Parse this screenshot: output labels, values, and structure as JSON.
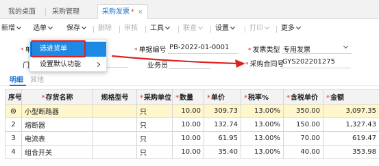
{
  "tabs": [
    {
      "label": "我的桌面"
    },
    {
      "label": "采购管理"
    },
    {
      "label": "采购发票",
      "modified_mark": "*",
      "close": "×"
    }
  ],
  "toolbar": {
    "add": "新增",
    "select_order": "选单",
    "save": "保存",
    "delete": "删除",
    "audit": "审核",
    "tools": "工具",
    "linked_query": "联查",
    "settings": "设置",
    "print": "打印",
    "more": "更多"
  },
  "menu": {
    "items": [
      {
        "label": "选进货单"
      },
      {
        "label": "设置默认功能"
      }
    ]
  },
  "form": {
    "doc_no_label": "单据编号",
    "doc_no_value": "PB-2022-01-0001",
    "invoice_type_label": "发票类型",
    "invoice_type_value": "专用发票",
    "salesman_label": "业务员",
    "purchase_contract_label": "采购合同号",
    "purchase_contract_value": "GYS202201275",
    "partial_label_1": "单",
    "partial_label_2": "门"
  },
  "subtabs": {
    "detail": "明细",
    "other": "其他"
  },
  "table": {
    "headers": [
      "序号",
      "存货名称",
      "规格型号",
      "采购单位",
      "数量",
      "单价",
      "税率%",
      "含税单价",
      "金额"
    ],
    "required": [
      false,
      true,
      false,
      true,
      true,
      true,
      true,
      true,
      true
    ],
    "rows": [
      {
        "no": "1",
        "name": "小型断路器",
        "spec": "",
        "unit": "只",
        "qty": "10.00",
        "price": "309.73",
        "tax": "13.00%",
        "tax_price": "350.00",
        "amount": "3,097.35"
      },
      {
        "no": "2",
        "name": "熔断器",
        "spec": "",
        "unit": "只",
        "qty": "10.00",
        "price": "132.74",
        "tax": "13.00%",
        "tax_price": "150.00",
        "amount": "1,327.43"
      },
      {
        "no": "3",
        "name": "电流表",
        "spec": "",
        "unit": "只",
        "qty": "10.00",
        "price": "61.95",
        "tax": "13.00%",
        "tax_price": "70.00",
        "amount": "619.47"
      },
      {
        "no": "4",
        "name": "组合开关",
        "spec": "",
        "unit": "只",
        "qty": "10.00",
        "price": "35.40",
        "tax": "13.00%",
        "tax_price": "40.00",
        "amount": "353.98"
      }
    ],
    "selected_row_icon": "row-marker-icon"
  },
  "colors": {
    "accent": "#1a6fd0",
    "menu_highlight": "#1e88e5",
    "annotation_red": "#e02020",
    "selected_row": "#fff6cc"
  }
}
